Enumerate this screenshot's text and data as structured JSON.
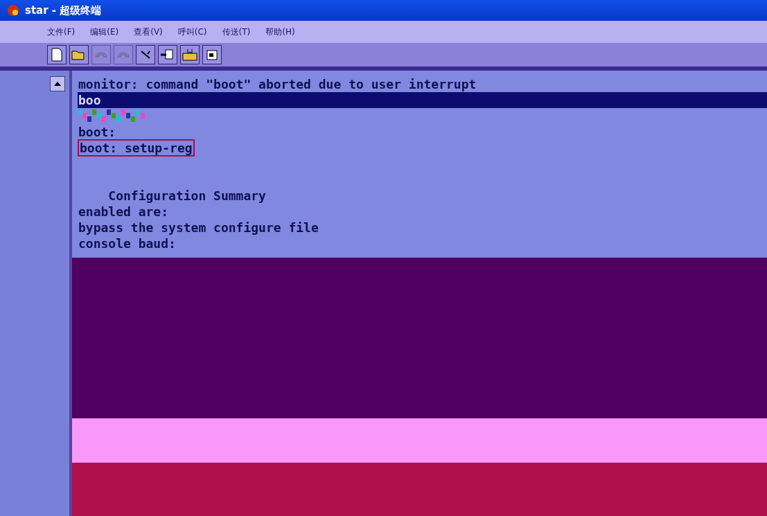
{
  "window": {
    "title": "star - 超级终端"
  },
  "menu": [
    {
      "label": "文件(F)"
    },
    {
      "label": "编辑(E)"
    },
    {
      "label": "查看(V)"
    },
    {
      "label": "呼叫(C)"
    },
    {
      "label": "传送(T)"
    },
    {
      "label": "帮助(H)"
    }
  ],
  "toolbar": [
    {
      "kind": "new",
      "disabled": false
    },
    {
      "kind": "open",
      "disabled": false
    },
    {
      "kind": "phone",
      "disabled": true
    },
    {
      "kind": "phone",
      "disabled": true
    },
    {
      "kind": "hangup",
      "disabled": false
    },
    {
      "kind": "send",
      "disabled": false
    },
    {
      "kind": "receive",
      "disabled": false
    },
    {
      "kind": "properties",
      "disabled": false
    }
  ],
  "terminal": {
    "lines": [
      {
        "kind": "normal",
        "text": "monitor: command \"boot\" aborted due to user interrupt"
      },
      {
        "kind": "highlight",
        "text": "boo"
      },
      {
        "kind": "garbled"
      },
      {
        "kind": "normal",
        "text": "boot:"
      },
      {
        "kind": "boxed",
        "text": "boot: setup-reg"
      },
      {
        "kind": "blank"
      },
      {
        "kind": "blank"
      },
      {
        "kind": "normal",
        "text": "    Configuration Summary"
      },
      {
        "kind": "normal",
        "text": "enabled are:"
      },
      {
        "kind": "normal",
        "text": "bypass the system configure file"
      },
      {
        "kind": "normal",
        "text": "console baud:"
      }
    ]
  }
}
